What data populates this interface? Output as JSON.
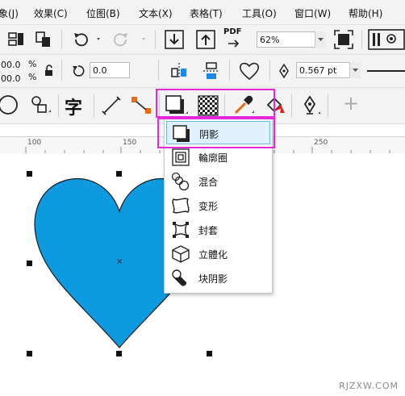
{
  "menubar": {
    "items": [
      {
        "label": "象(J)"
      },
      {
        "label": "效果(C)"
      },
      {
        "label": "位图(B)"
      },
      {
        "label": "文本(X)"
      },
      {
        "label": "表格(T)"
      },
      {
        "label": "工具(O)"
      },
      {
        "label": "窗口(W)"
      },
      {
        "label": "帮助(H)"
      }
    ]
  },
  "toolbar1": {
    "zoom_value": "62%",
    "pdf_label": "PDF",
    "icons": [
      "new-document-icon",
      "paste-icon",
      "undo-icon",
      "redo-icon",
      "import-icon",
      "export-icon",
      "pdf-export-icon",
      "full-screen-icon",
      "options-icon"
    ]
  },
  "propbar": {
    "x_value": "00.0",
    "y_value": "00.0",
    "percent1": "%",
    "percent2": "%",
    "rotation_value": "0.0",
    "outline_width": "0.567 pt"
  },
  "toolbox": {
    "text_tool_glyph": "字",
    "add_glyph": "+"
  },
  "ruler": {
    "ticks": [
      "100",
      "150",
      "200",
      "250"
    ]
  },
  "effects_menu": {
    "items": [
      {
        "label": "阴影",
        "icon": "drop-shadow-icon",
        "selected": true
      },
      {
        "label": "輪廓圈",
        "icon": "contour-icon",
        "selected": false
      },
      {
        "label": "混合",
        "icon": "blend-icon",
        "selected": false
      },
      {
        "label": "变形",
        "icon": "distort-icon",
        "selected": false
      },
      {
        "label": "封套",
        "icon": "envelope-icon",
        "selected": false
      },
      {
        "label": "立體化",
        "icon": "extrude-icon",
        "selected": false
      },
      {
        "label": "块阴影",
        "icon": "block-shadow-icon",
        "selected": false
      }
    ]
  },
  "shape": {
    "fill_color": "#0d9ae0",
    "outline_color": "#1a1a1a",
    "center_mark": "×"
  },
  "highlight_color": "#e528d8",
  "watermark": "RJZXW.COM"
}
